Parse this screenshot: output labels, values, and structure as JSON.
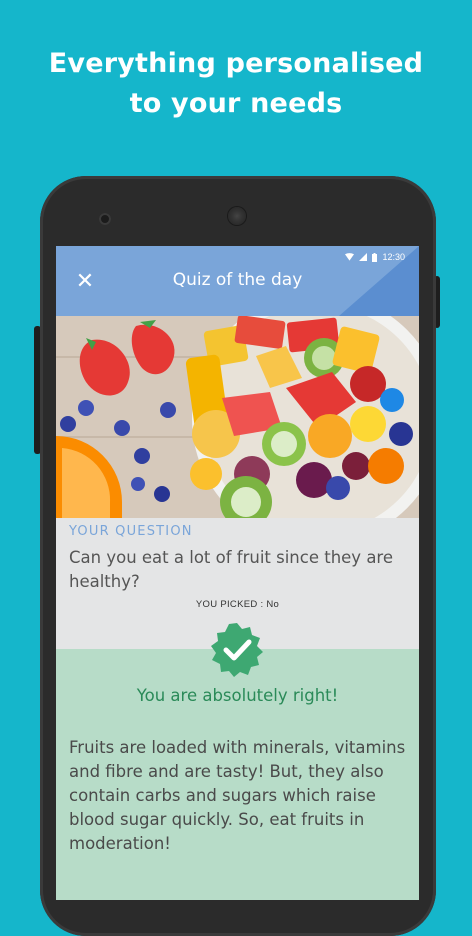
{
  "promo": {
    "headline_line1": "Everything personalised",
    "headline_line2": "to your needs"
  },
  "status_bar": {
    "time": "12:30",
    "icons": [
      "wifi-icon",
      "signal-icon",
      "battery-icon"
    ]
  },
  "app_bar": {
    "title": "Quiz of the day",
    "close_icon": "close-icon",
    "close_glyph": "✕"
  },
  "question": {
    "label": "YOUR QUESTION",
    "text": "Can you eat a lot of fruit since they are healthy?",
    "picked_label": "YOU PICKED : No"
  },
  "answer": {
    "badge_icon": "check-badge-icon",
    "result": "You are absolutely right!",
    "explanation": "Fruits are loaded with minerals, vitamins and fibre and are tasty! But, they also contain carbs and sugars which raise blood sugar quickly. So, eat fruits in moderation!"
  },
  "colors": {
    "background": "#15b6cb",
    "app_bar": "#7aa5d9",
    "question_label": "#7aa5d9",
    "answer_bg": "#b7dcc8",
    "answer_text": "#2a8a58",
    "badge": "#3ea872"
  }
}
